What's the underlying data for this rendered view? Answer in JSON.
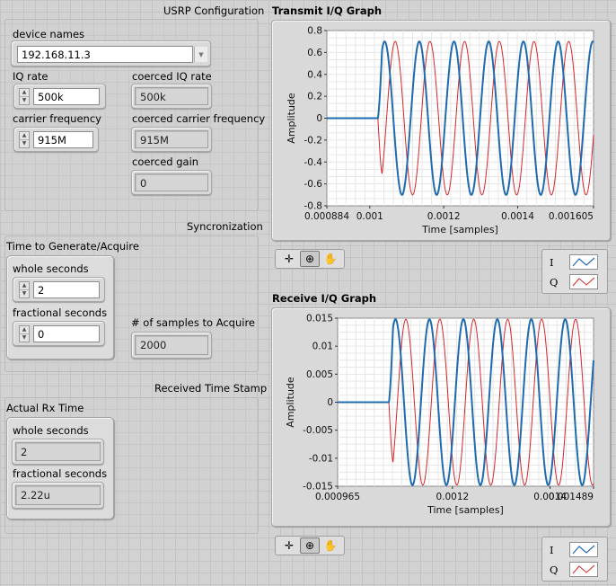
{
  "usrp": {
    "title": "USRP Configuration",
    "device_names_label": "device names",
    "device_names_value": "192.168.11.3",
    "iq_rate_label": "IQ rate",
    "iq_rate_value": "500k",
    "coerced_iq_rate_label": "coerced IQ rate",
    "coerced_iq_rate_value": "500k",
    "carrier_freq_label": "carrier frequency",
    "carrier_freq_value": "915M",
    "coerced_carrier_label": "coerced carrier frequency",
    "coerced_carrier_value": "915M",
    "coerced_gain_label": "coerced gain",
    "coerced_gain_value": "0"
  },
  "sync": {
    "title": "Syncronization",
    "tga_label": "Time to Generate/Acquire",
    "whole_seconds_label": "whole seconds",
    "whole_seconds_value": "2",
    "fractional_seconds_label": "fractional seconds",
    "fractional_seconds_value": "0",
    "samples_label": "# of samples to Acquire",
    "samples_value": "2000"
  },
  "rx_stamp": {
    "title": "Received Time Stamp",
    "actual_label": "Actual Rx Time",
    "whole_seconds_label": "whole seconds",
    "whole_seconds_value": "2",
    "fractional_seconds_label": "fractional seconds",
    "fractional_seconds_value": "2.22u"
  },
  "colors": {
    "i_trace": "#1f6bb0",
    "q_trace": "#d9262b",
    "plot_bg": "#ffffff",
    "grid": "#e6e6e6"
  },
  "legend": {
    "i_label": "I",
    "q_label": "Q"
  },
  "palette_icons": [
    "cursor-crosshair-icon",
    "zoom-icon",
    "pan-hand-icon"
  ],
  "chart_data": [
    {
      "type": "line",
      "title": "Transmit I/Q Graph",
      "xlabel": "Time [samples]",
      "ylabel": "Amplitude",
      "xlim": [
        0.000884,
        0.001605
      ],
      "ylim": [
        -0.8,
        0.8
      ],
      "grid": true,
      "legend_position": "bottom-right",
      "x_ticks": [
        "0.000884",
        "0.001",
        "0.0012",
        "0.0014",
        "0.001605"
      ],
      "y_ticks": [
        "0.8",
        "0.6",
        "0.4",
        "0.2",
        "0",
        "-0.2",
        "-0.4",
        "-0.6",
        "-0.8"
      ],
      "series": [
        {
          "name": "I",
          "onset": 0.001022,
          "amplitude": 0.7,
          "period": 9.38e-05,
          "phase": "sine"
        },
        {
          "name": "Q",
          "onset": 0.001022,
          "amplitude": 0.7,
          "period": 9.38e-05,
          "phase": "cosine"
        }
      ]
    },
    {
      "type": "line",
      "title": "Receive I/Q Graph",
      "xlabel": "Time [samples]",
      "ylabel": "Amplitude",
      "xlim": [
        0.000965,
        0.001489
      ],
      "ylim": [
        -0.015,
        0.015
      ],
      "grid": true,
      "legend_position": "bottom-right",
      "x_ticks": [
        "0.000965",
        "0.0012",
        "0.0014",
        "0.001489"
      ],
      "y_ticks": [
        "0.015",
        "0.01",
        "0.005",
        "0",
        "-0.005",
        "-0.01",
        "-0.015"
      ],
      "series": [
        {
          "name": "I",
          "onset": 0.00107,
          "amplitude": 0.0148,
          "period": 6.95e-05,
          "phase": "sine"
        },
        {
          "name": "Q",
          "onset": 0.00107,
          "amplitude": 0.0148,
          "period": 6.95e-05,
          "phase": "cosine"
        }
      ]
    }
  ]
}
